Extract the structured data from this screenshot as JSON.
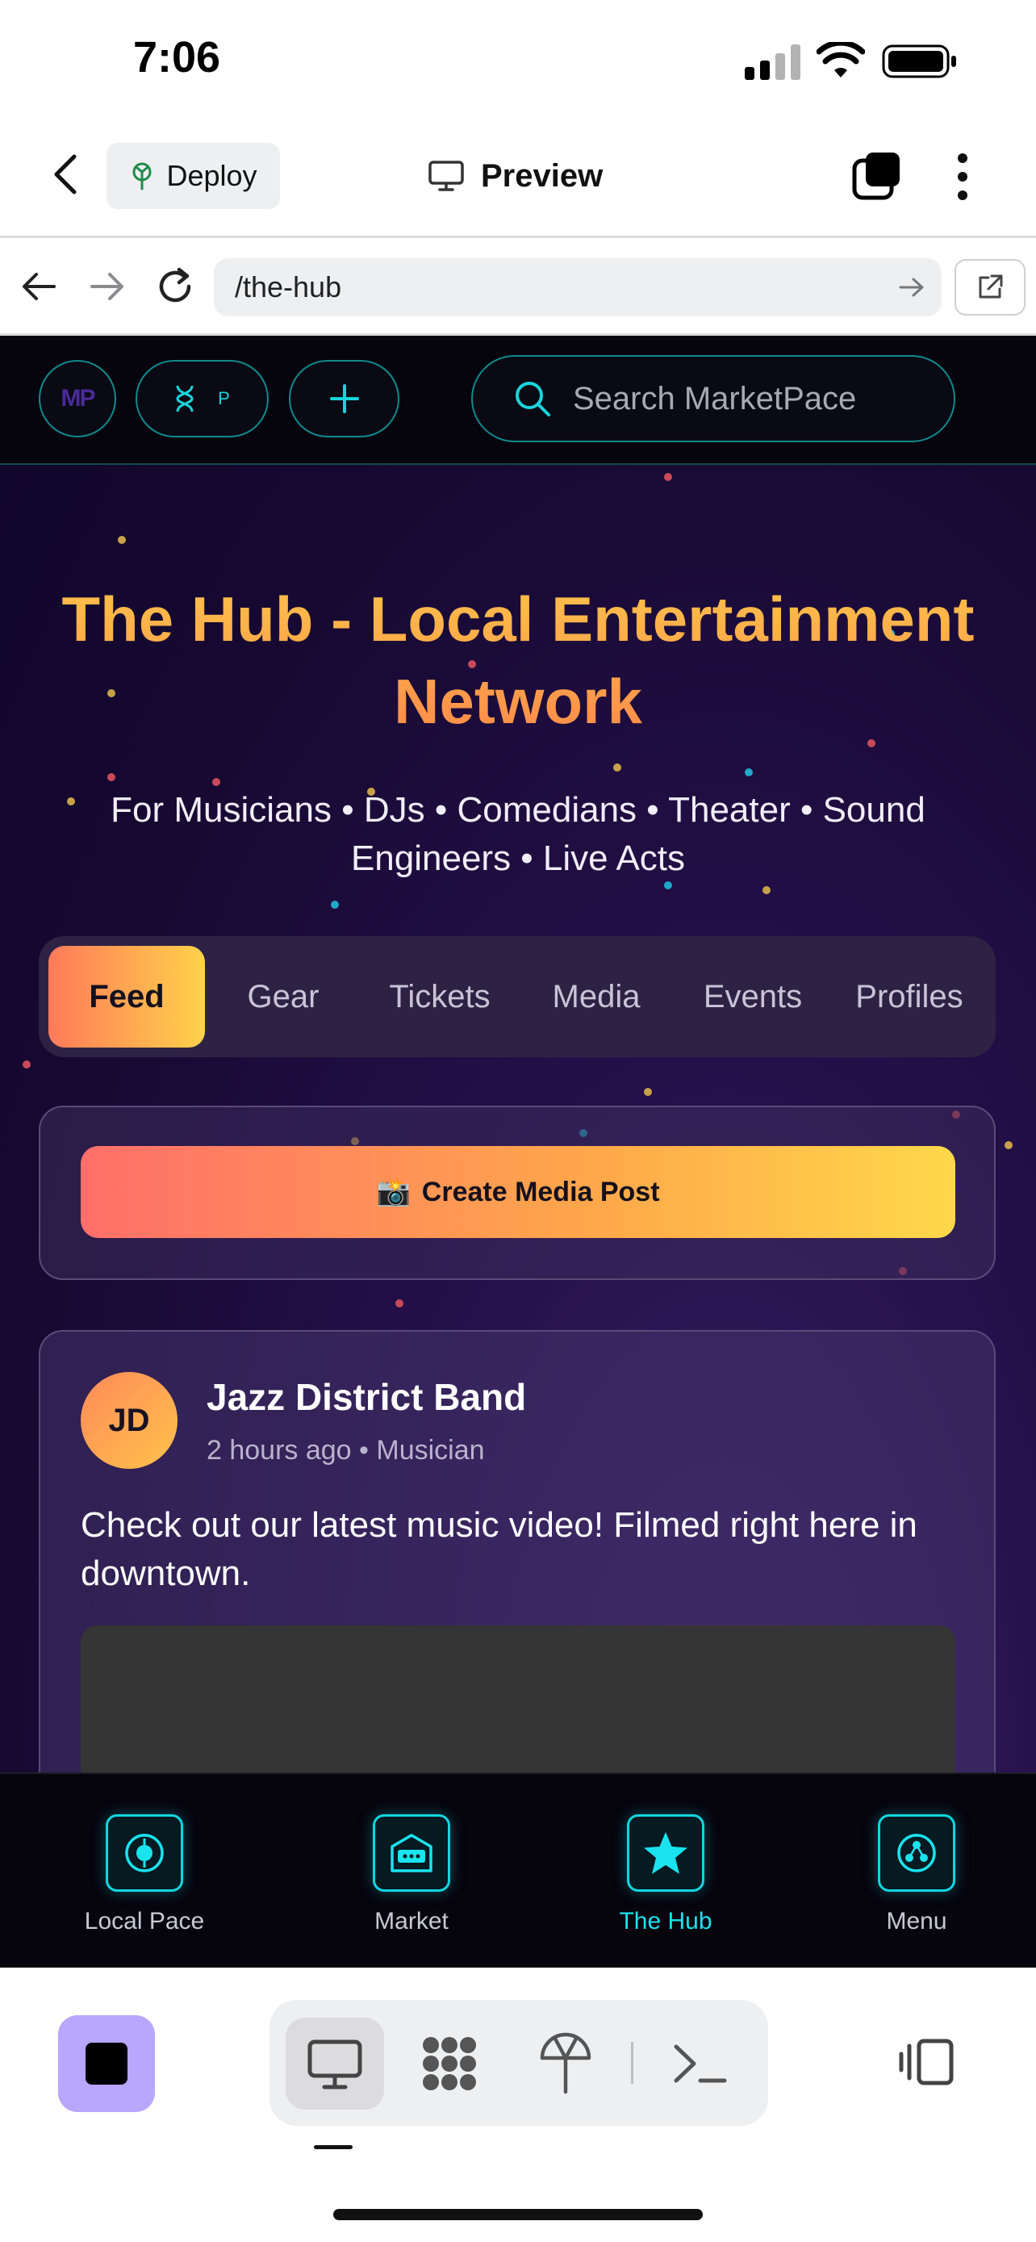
{
  "status_bar": {
    "time": "7:06"
  },
  "app_bar": {
    "deploy_label": "Deploy",
    "preview_label": "Preview"
  },
  "browser": {
    "url": "/the-hub"
  },
  "site_header": {
    "logo_text": "MP",
    "profile_letter": "P",
    "search_placeholder": "Search MarketPace",
    "accent_color": "#12d6df"
  },
  "hero": {
    "title": "The Hub - Local Entertainment Network",
    "subtitle": "For Musicians • DJs • Comedians • Theater • Sound Engineers • Live Acts"
  },
  "tabs": [
    {
      "label": "Feed",
      "active": true
    },
    {
      "label": "Gear",
      "active": false
    },
    {
      "label": "Tickets",
      "active": false
    },
    {
      "label": "Media",
      "active": false
    },
    {
      "label": "Events",
      "active": false
    },
    {
      "label": "Profiles",
      "active": false
    }
  ],
  "create_post": {
    "icon": "📸",
    "label": "Create Media Post"
  },
  "post": {
    "initials": "JD",
    "author": "Jazz District Band",
    "meta": "2 hours ago • Musician",
    "body": "Check out our latest music video! Filmed right here in downtown."
  },
  "bottom_nav": [
    {
      "label": "Local Pace",
      "icon": "local-pace-icon",
      "active": false
    },
    {
      "label": "Market",
      "icon": "market-icon",
      "active": false
    },
    {
      "label": "The Hub",
      "icon": "star-icon",
      "active": true
    },
    {
      "label": "Menu",
      "icon": "menu-icon",
      "active": false
    }
  ],
  "toolbar": {
    "active_segment": "preview"
  }
}
